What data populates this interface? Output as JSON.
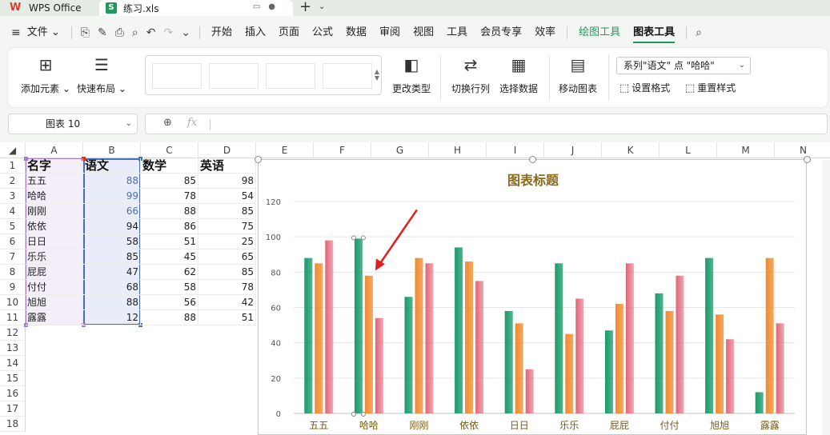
{
  "titlebar": {
    "app_tab": "WPS Office",
    "file_tab": "练习.xls",
    "file_icon_letter": "S",
    "add_tab": "+"
  },
  "menu": {
    "file": "文件",
    "items": [
      "开始",
      "插入",
      "页面",
      "公式",
      "数据",
      "审阅",
      "视图",
      "工具",
      "会员专享",
      "效率"
    ],
    "draw_tools": "绘图工具",
    "chart_tools": "图表工具"
  },
  "ribbon": {
    "add_element": "添加元素",
    "quick_layout": "快速布局",
    "change_type": "更改类型",
    "switch_row_col": "切换行列",
    "select_data": "选择数据",
    "move_chart": "移动图表",
    "series_select": "系列\"语文\" 点 \"哈哈\"",
    "set_format": "设置格式",
    "reset_style": "重置样式"
  },
  "formula_bar": {
    "name_box": "图表 10",
    "fx": "fx"
  },
  "sheet": {
    "columns": [
      "A",
      "B",
      "C",
      "D",
      "E",
      "F",
      "G",
      "H",
      "I",
      "J",
      "K",
      "L",
      "M",
      "N"
    ],
    "rows": [
      "1",
      "2",
      "3",
      "4",
      "5",
      "6",
      "7",
      "8",
      "9",
      "10",
      "11",
      "12",
      "13",
      "14",
      "15",
      "16",
      "17",
      "18"
    ],
    "headers": [
      "名字",
      "语文",
      "数学",
      "英语"
    ],
    "data": [
      [
        "五五",
        "88",
        "85",
        "98"
      ],
      [
        "哈哈",
        "99",
        "78",
        "54"
      ],
      [
        "刚刚",
        "66",
        "88",
        "85"
      ],
      [
        "依依",
        "94",
        "86",
        "75"
      ],
      [
        "日日",
        "58",
        "51",
        "25"
      ],
      [
        "乐乐",
        "85",
        "45",
        "65"
      ],
      [
        "屁屁",
        "47",
        "62",
        "85"
      ],
      [
        "付付",
        "68",
        "58",
        "78"
      ],
      [
        "旭旭",
        "88",
        "56",
        "42"
      ],
      [
        "露露",
        "12",
        "88",
        "51"
      ]
    ]
  },
  "chart_data": {
    "type": "bar",
    "title": "图表标题",
    "categories": [
      "五五",
      "哈哈",
      "刚刚",
      "依依",
      "日日",
      "乐乐",
      "屁屁",
      "付付",
      "旭旭",
      "露露"
    ],
    "series": [
      {
        "values": [
          88,
          99,
          66,
          94,
          58,
          85,
          47,
          68,
          88,
          12
        ],
        "color": "#1a9a6a"
      },
      {
        "values": [
          85,
          78,
          88,
          86,
          51,
          45,
          62,
          58,
          56,
          88
        ],
        "color": "#f08a2e"
      },
      {
        "values": [
          98,
          54,
          85,
          75,
          25,
          65,
          85,
          78,
          42,
          51
        ],
        "color": "#e06478"
      }
    ],
    "ylim": [
      0,
      120
    ],
    "yticks": [
      "0",
      "20",
      "40",
      "60",
      "80",
      "100",
      "120"
    ],
    "grid": true,
    "selected_point": {
      "series": 0,
      "category": 1
    }
  },
  "colors": {
    "accent": "#1e9b5b",
    "selection_blue": "#4a6fb5",
    "selection_purple": "#a37ec5",
    "annotation_arrow": "#e02020"
  }
}
